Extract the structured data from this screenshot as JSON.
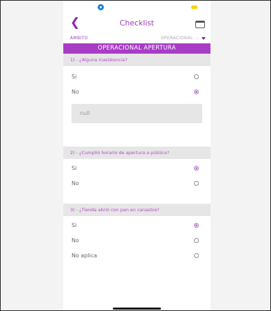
{
  "header": {
    "title": "Checklist"
  },
  "ambito": {
    "label": "ÁMBITO",
    "selected": "OPERACIONAL ..."
  },
  "section": {
    "title": "OPERACIONAL APERTURA"
  },
  "questions": [
    {
      "label": "1) - ¿Alguna inasistencia?",
      "options": [
        "Si",
        "No"
      ],
      "selected": "No",
      "note": "null"
    },
    {
      "label": "2) - ¿Cumplió horario de apertura a público?",
      "options": [
        "Si",
        "No"
      ],
      "selected": "Si"
    },
    {
      "label": "3) - ¿Tienda abrió con pan en canastos?",
      "options": [
        "Si",
        "No",
        "No aplica"
      ],
      "selected": "Si"
    }
  ],
  "colors": {
    "accent": "#a83cc4",
    "status_location": "#1f7fd6",
    "status_battery": "#f2d31a"
  }
}
